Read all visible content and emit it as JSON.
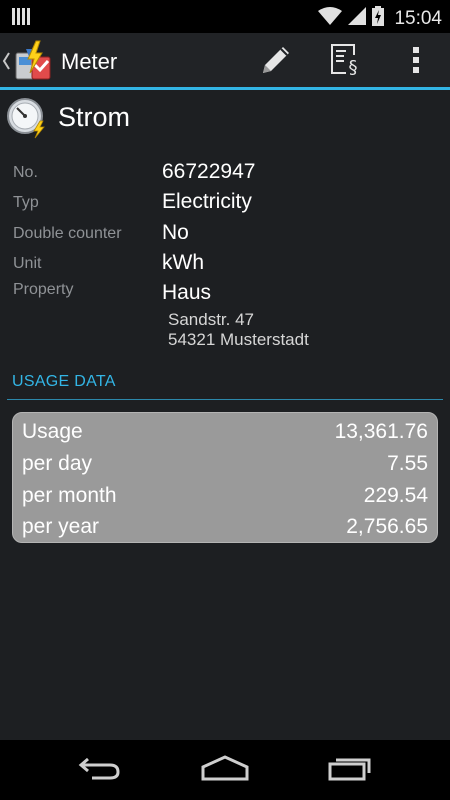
{
  "status_bar": {
    "time": "15:04"
  },
  "action_bar": {
    "title": "Meter"
  },
  "meter": {
    "name": "Strom"
  },
  "details": [
    {
      "label": "No.",
      "value": "66722947"
    },
    {
      "label": "Typ",
      "value": "Electricity"
    },
    {
      "label": "Double counter",
      "value": "No"
    },
    {
      "label": "Unit",
      "value": "kWh"
    },
    {
      "label": "Property",
      "value": "Haus"
    }
  ],
  "address": {
    "street": "Sandstr. 47",
    "city": "54321 Musterstadt"
  },
  "usage_section": {
    "title": "USAGE DATA",
    "rows": [
      {
        "label": "Usage",
        "value": "13,361.76"
      },
      {
        "label": "per day",
        "value": "7.55"
      },
      {
        "label": "per month",
        "value": "229.54"
      },
      {
        "label": "per year",
        "value": "2,756.65"
      }
    ]
  },
  "colors": {
    "accent": "#33b5e5",
    "background": "#1d1f22",
    "usage_box": "#9a9a9a"
  }
}
